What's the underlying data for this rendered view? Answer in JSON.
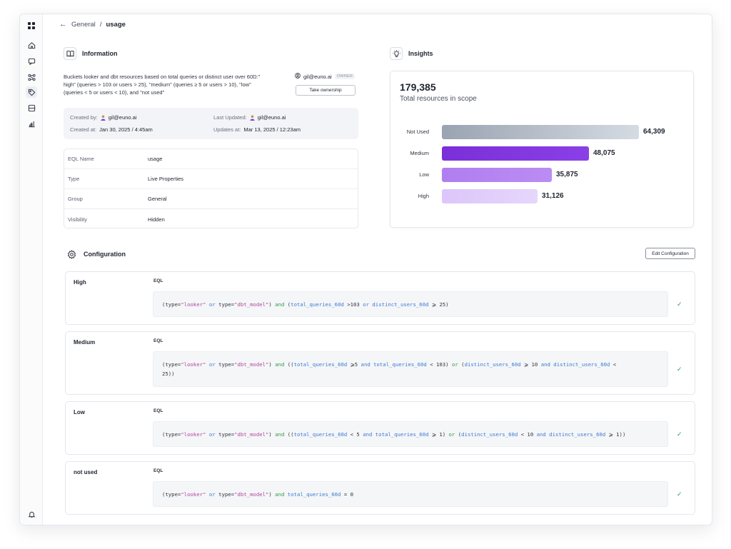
{
  "breadcrumb": {
    "parent": "General",
    "separator": "/",
    "current": "usage"
  },
  "information": {
    "title": "Information",
    "description": "Buckets looker and dbt resources based on total queries or distinct user over 60D:\" high\" (queries > 103 or users > 25), \"medium\" (queries ≥ 5 or users > 10), \"low\" (queries < 5 or users < 10), and \"not used\"",
    "owner_email": "gil@euno.ai",
    "owner_badge": "OWNER",
    "take_ownership": "Take ownership",
    "meta": {
      "created_by_label": "Created by:",
      "created_by": "gil@euno.ai",
      "created_at_label": "Created at:",
      "created_at": "Jan 30, 2025 / 4:45am",
      "last_updated_label": "Last Updated:",
      "last_updated": "gil@euno.ai",
      "updates_at_label": "Updates at:",
      "updates_at": "Mar 13, 2025 / 12:23am"
    },
    "properties": [
      {
        "key": "EQL Name",
        "value": "usage"
      },
      {
        "key": "Type",
        "value": "Live Properties"
      },
      {
        "key": "Group",
        "value": "General"
      },
      {
        "key": "Visibility",
        "value": "Hidden"
      }
    ]
  },
  "insights": {
    "title": "Insights",
    "total": "179,385",
    "total_label": "Total resources in scope",
    "buckets": [
      {
        "label": "Not Used",
        "value": 64309,
        "display": "64,309",
        "color_from": "#9aa3b1",
        "color_to": "#d5dbe3"
      },
      {
        "label": "Medium",
        "value": 48075,
        "display": "48,075",
        "color_from": "#7a2fd8",
        "color_to": "#8b3fe6"
      },
      {
        "label": "Low",
        "value": 35875,
        "display": "35,875",
        "color_from": "#b07ef0",
        "color_to": "#bb8cf3"
      },
      {
        "label": "High",
        "value": 31126,
        "display": "31,126",
        "color_from": "#dcc6fa",
        "color_to": "#e6d6fb"
      }
    ]
  },
  "configuration": {
    "title": "Configuration",
    "edit_button": "Edit Configuration",
    "eql_label": "EQL",
    "rules": [
      {
        "name": "High"
      },
      {
        "name": "Medium"
      },
      {
        "name": "Low"
      },
      {
        "name": "not used"
      }
    ]
  },
  "icons": {
    "rail": [
      "apps-icon",
      "home-icon",
      "chat-icon",
      "graph-icon",
      "tag-icon",
      "database-icon",
      "chart-icon",
      "bell-icon"
    ],
    "check": "check-icon"
  },
  "colors": {
    "success": "#2e9b4a",
    "accent": "#7a2fd8",
    "string": "#b0489e",
    "field": "#3b7bd4"
  }
}
